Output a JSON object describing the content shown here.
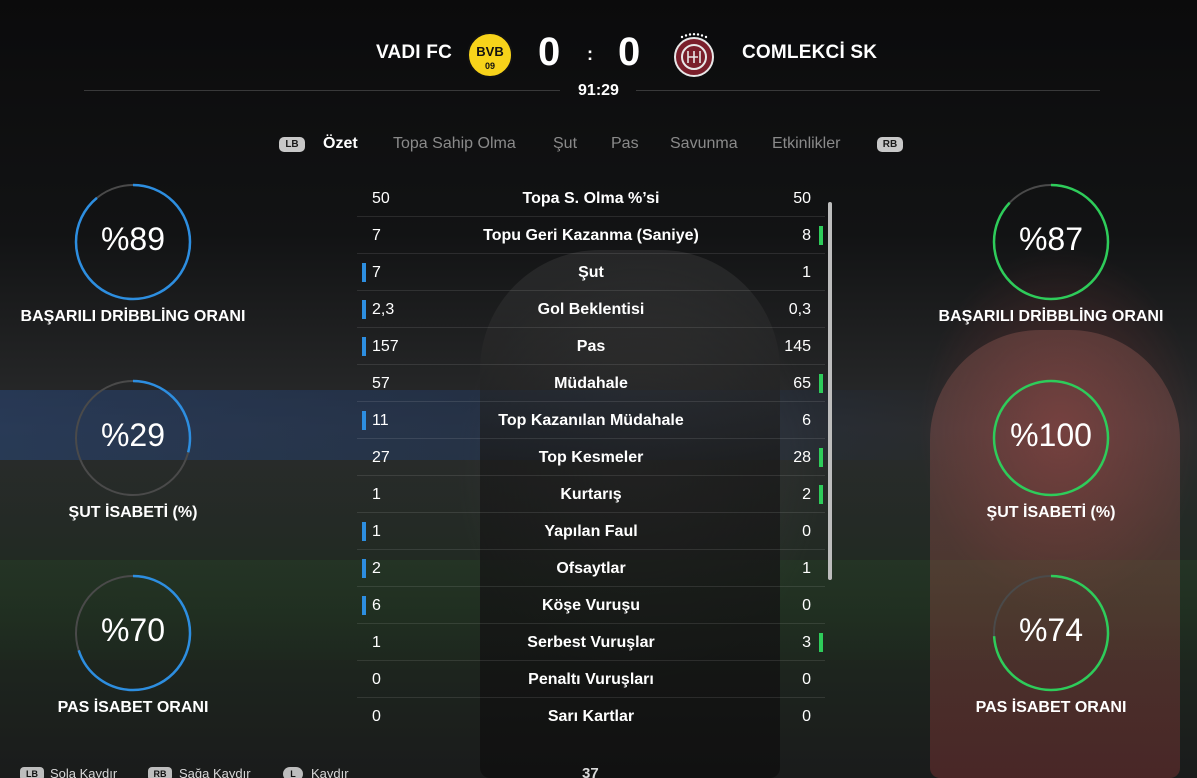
{
  "match": {
    "home_team": "VADI FC",
    "away_team": "COMLEKCİ SK",
    "home_score": "0",
    "away_score": "0",
    "separator": ":",
    "clock": "91:29",
    "home_crest_text": "BVB",
    "home_crest_sub": "09"
  },
  "tabs": {
    "lb": "LB",
    "rb": "RB",
    "items": [
      "Özet",
      "Topa Sahip Olma",
      "Şut",
      "Pas",
      "Savunma",
      "Etkinlikler"
    ]
  },
  "gauges": {
    "home": [
      {
        "value_text": "%89",
        "value": 89,
        "label": "BAŞARILI DRİBBLİNG ORANI"
      },
      {
        "value_text": "%29",
        "value": 29,
        "label": "ŞUT İSABETİ (%)"
      },
      {
        "value_text": "%70",
        "value": 70,
        "label": "PAS İSABET ORANI"
      }
    ],
    "away": [
      {
        "value_text": "%87",
        "value": 87,
        "label": "BAŞARILI DRİBBLİNG ORANI"
      },
      {
        "value_text": "%100",
        "value": 100,
        "label": "ŞUT İSABETİ (%)"
      },
      {
        "value_text": "%74",
        "value": 74,
        "label": "PAS İSABET ORANI"
      }
    ],
    "home_color": "#2d8ee0",
    "away_color": "#2ecc5a"
  },
  "stats": [
    {
      "home": "50",
      "label": "Topa S. Olma %’si",
      "away": "50",
      "leader": "none"
    },
    {
      "home": "7",
      "label": "Topu Geri Kazanma (Saniye)",
      "away": "8",
      "leader": "away"
    },
    {
      "home": "7",
      "label": "Şut",
      "away": "1",
      "leader": "home"
    },
    {
      "home": "2,3",
      "label": "Gol Beklentisi",
      "away": "0,3",
      "leader": "home"
    },
    {
      "home": "157",
      "label": "Pas",
      "away": "145",
      "leader": "home"
    },
    {
      "home": "57",
      "label": "Müdahale",
      "away": "65",
      "leader": "away"
    },
    {
      "home": "11",
      "label": "Top Kazanılan Müdahale",
      "away": "6",
      "leader": "home"
    },
    {
      "home": "27",
      "label": "Top Kesmeler",
      "away": "28",
      "leader": "away"
    },
    {
      "home": "1",
      "label": "Kurtarış",
      "away": "2",
      "leader": "away"
    },
    {
      "home": "1",
      "label": "Yapılan Faul",
      "away": "0",
      "leader": "home"
    },
    {
      "home": "2",
      "label": "Ofsaytlar",
      "away": "1",
      "leader": "home"
    },
    {
      "home": "6",
      "label": "Köşe Vuruşu",
      "away": "0",
      "leader": "home"
    },
    {
      "home": "1",
      "label": "Serbest Vuruşlar",
      "away": "3",
      "leader": "away"
    },
    {
      "home": "0",
      "label": "Penaltı Vuruşları",
      "away": "0",
      "leader": "none"
    },
    {
      "home": "0",
      "label": "Sarı Kartlar",
      "away": "0",
      "leader": "none"
    }
  ],
  "hints": {
    "lb": "LB",
    "rb": "RB",
    "l": "L",
    "scroll_left": "Sola Kaydır",
    "scroll_right": "Sağa Kaydır",
    "scroll": "Kaydır",
    "page": "37"
  }
}
